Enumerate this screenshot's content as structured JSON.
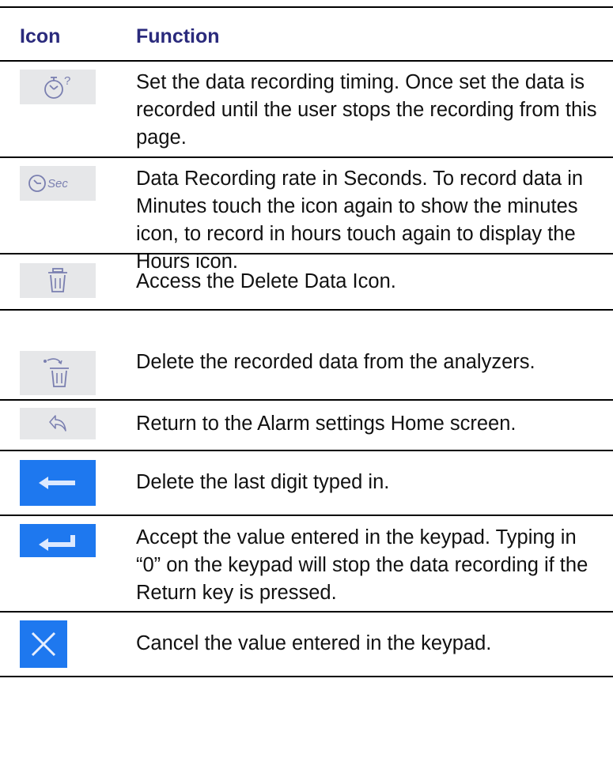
{
  "headers": {
    "icon": "Icon",
    "function": "Function"
  },
  "rows": [
    {
      "icon": "timer-question-icon",
      "text": "Set the data recording timing. Once set the data is recorded until the user stops the recording from this page."
    },
    {
      "icon": "clock-seconds-icon",
      "icon_text": "Sec",
      "text": "Data Recording rate in Seconds. To record data in Minutes touch the icon again to show the minutes icon, to record in hours touch again to display the Hours icon."
    },
    {
      "icon": "trash-icon",
      "text": "Access the Delete Data Icon."
    },
    {
      "icon": "trash-delete-icon",
      "text": "Delete the recorded data from the analyzers."
    },
    {
      "icon": "return-arrow-icon",
      "text": "Return to the Alarm settings Home screen."
    },
    {
      "icon": "backspace-arrow-icon",
      "text": "Delete the last digit typed in."
    },
    {
      "icon": "enter-key-icon",
      "text": "Accept the value entered in the keypad. Typing in “0” on the keypad will stop the data recording if the Return key is pressed."
    },
    {
      "icon": "cancel-x-icon",
      "text": "Cancel the value entered in the keypad."
    }
  ],
  "colors": {
    "header_text": "#2a2a7c",
    "icon_gray_bg": "#e6e7e9",
    "icon_blue_bg": "#1e78ef",
    "icon_stroke": "#7a7fb0"
  }
}
